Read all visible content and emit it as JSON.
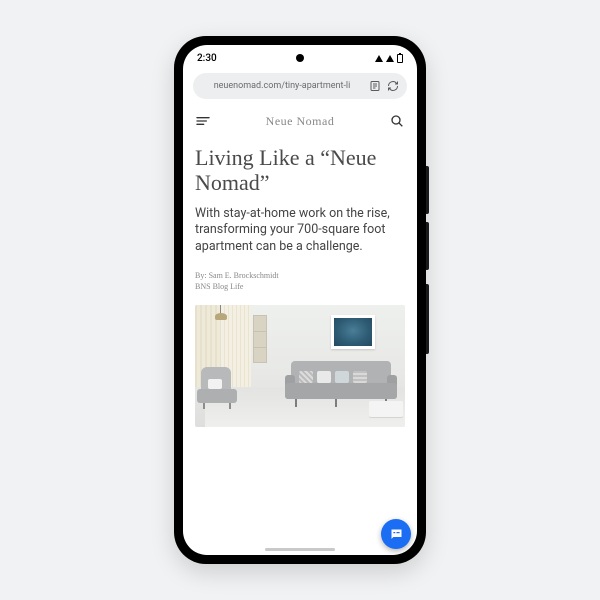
{
  "status": {
    "time": "2:30"
  },
  "browser": {
    "url": "neuenomad.com/tiny-apartment-li"
  },
  "site": {
    "title": "Neue Nomad"
  },
  "article": {
    "headline": "Living Like a “Neue Nomad”",
    "subhead": "With stay-at-home work on the rise, transforming your 700-square foot apartment can be a challenge.",
    "byline_prefix": "By: ",
    "author": "Sam E. Brockschmidt",
    "publication": "BNS Blog Life"
  }
}
